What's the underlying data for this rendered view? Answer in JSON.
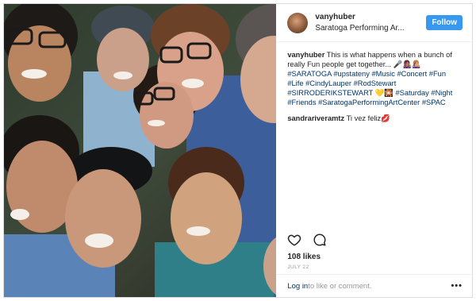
{
  "post": {
    "username": "vanyhuber",
    "location": "Saratoga Performing Ar...",
    "follow_label": "Follow",
    "caption_user": "vanyhuber",
    "caption_text": "This is what happens when a bunch of really Fun people get together... 🎤👩🏽‍🎤👩🏼‍🎤",
    "hashtags": [
      "#SARATOGA",
      "#upstateny",
      "#Music",
      "#Concert",
      "#Fun",
      "#Life",
      "#CindyLauper",
      "#RodStewart",
      "#SIRRODERIKSTEWART",
      "💛🎇",
      "#Saturday",
      "#Night",
      "#Friends",
      "#SaratogaPerformingArtCenter",
      "#SPAC"
    ],
    "comment_user": "sandrariveramtz",
    "comment_text": "Ti vez feliz💋",
    "likes": "108 likes",
    "date": "JULY 22",
    "login_link": "Log in",
    "login_rest": " to like or comment.",
    "more_label": "•••"
  },
  "icons": {
    "like": "heart-icon",
    "comment": "comment-bubble-icon",
    "avatar": "user-avatar",
    "more": "more-options-icon"
  },
  "colors": {
    "follow": "#3897f0",
    "link": "#003569",
    "muted": "#999999"
  }
}
